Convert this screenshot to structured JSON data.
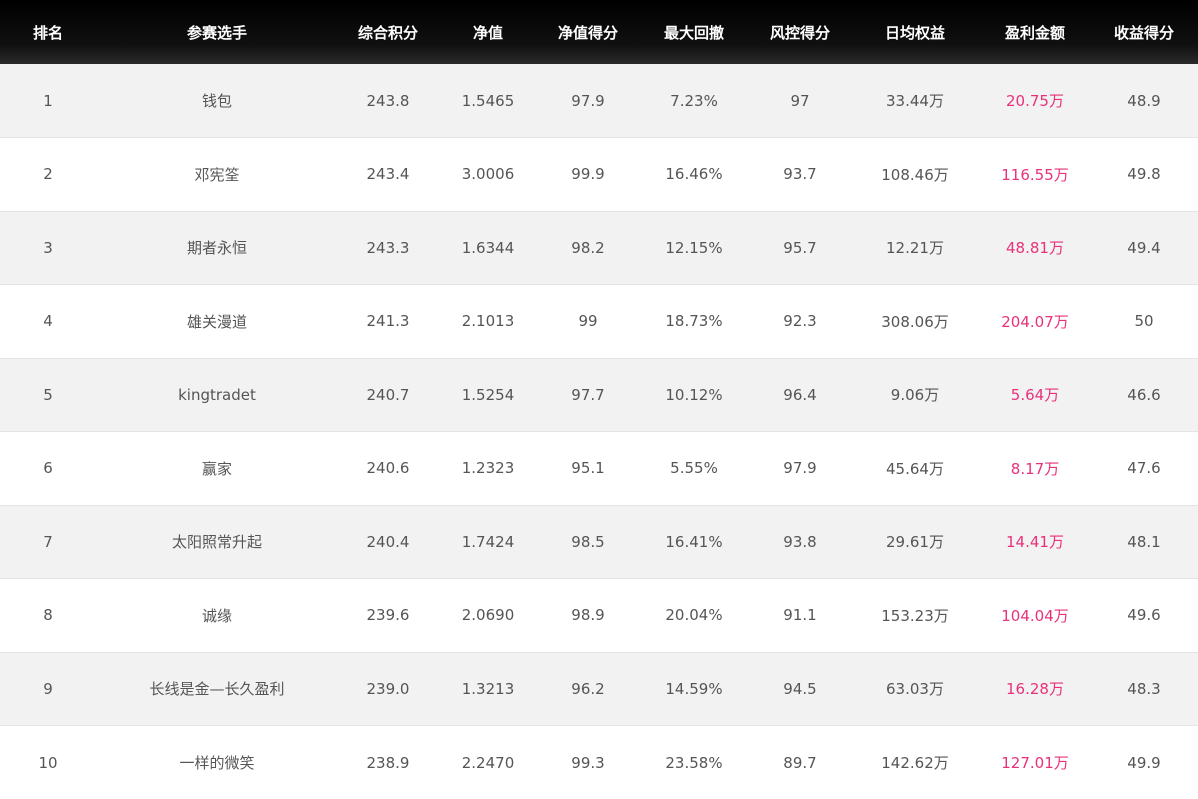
{
  "table": {
    "headers": {
      "rank": "排名",
      "player": "参赛选手",
      "total_score": "综合积分",
      "net_value": "净值",
      "net_value_score": "净值得分",
      "max_drawdown": "最大回撤",
      "risk_score": "风控得分",
      "daily_equity": "日均权益",
      "profit": "盈利金额",
      "return_score": "收益得分"
    },
    "rows": [
      {
        "rank": "1",
        "player": "钱包",
        "total_score": "243.8",
        "net_value": "1.5465",
        "net_value_score": "97.9",
        "max_drawdown": "7.23%",
        "risk_score": "97",
        "daily_equity": "33.44万",
        "profit": "20.75万",
        "return_score": "48.9"
      },
      {
        "rank": "2",
        "player": "邓宪筌",
        "total_score": "243.4",
        "net_value": "3.0006",
        "net_value_score": "99.9",
        "max_drawdown": "16.46%",
        "risk_score": "93.7",
        "daily_equity": "108.46万",
        "profit": "116.55万",
        "return_score": "49.8"
      },
      {
        "rank": "3",
        "player": "期者永恒",
        "total_score": "243.3",
        "net_value": "1.6344",
        "net_value_score": "98.2",
        "max_drawdown": "12.15%",
        "risk_score": "95.7",
        "daily_equity": "12.21万",
        "profit": "48.81万",
        "return_score": "49.4"
      },
      {
        "rank": "4",
        "player": "雄关漫道",
        "total_score": "241.3",
        "net_value": "2.1013",
        "net_value_score": "99",
        "max_drawdown": "18.73%",
        "risk_score": "92.3",
        "daily_equity": "308.06万",
        "profit": "204.07万",
        "return_score": "50"
      },
      {
        "rank": "5",
        "player": "kingtradet",
        "total_score": "240.7",
        "net_value": "1.5254",
        "net_value_score": "97.7",
        "max_drawdown": "10.12%",
        "risk_score": "96.4",
        "daily_equity": "9.06万",
        "profit": "5.64万",
        "return_score": "46.6"
      },
      {
        "rank": "6",
        "player": "赢家",
        "total_score": "240.6",
        "net_value": "1.2323",
        "net_value_score": "95.1",
        "max_drawdown": "5.55%",
        "risk_score": "97.9",
        "daily_equity": "45.64万",
        "profit": "8.17万",
        "return_score": "47.6"
      },
      {
        "rank": "7",
        "player": "太阳照常升起",
        "total_score": "240.4",
        "net_value": "1.7424",
        "net_value_score": "98.5",
        "max_drawdown": "16.41%",
        "risk_score": "93.8",
        "daily_equity": "29.61万",
        "profit": "14.41万",
        "return_score": "48.1"
      },
      {
        "rank": "8",
        "player": "诚缘",
        "total_score": "239.6",
        "net_value": "2.0690",
        "net_value_score": "98.9",
        "max_drawdown": "20.04%",
        "risk_score": "91.1",
        "daily_equity": "153.23万",
        "profit": "104.04万",
        "return_score": "49.6"
      },
      {
        "rank": "9",
        "player": "长线是金—长久盈利",
        "total_score": "239.0",
        "net_value": "1.3213",
        "net_value_score": "96.2",
        "max_drawdown": "14.59%",
        "risk_score": "94.5",
        "daily_equity": "63.03万",
        "profit": "16.28万",
        "return_score": "48.3"
      },
      {
        "rank": "10",
        "player": "一样的微笑",
        "total_score": "238.9",
        "net_value": "2.2470",
        "net_value_score": "99.3",
        "max_drawdown": "23.58%",
        "risk_score": "89.7",
        "daily_equity": "142.62万",
        "profit": "127.01万",
        "return_score": "49.9"
      }
    ]
  },
  "colors": {
    "header_bg": "#000000",
    "header_text": "#ffffff",
    "row_odd_bg": "#f2f2f2",
    "row_even_bg": "#ffffff",
    "body_text": "#555555",
    "profit_text": "#e8317a"
  }
}
